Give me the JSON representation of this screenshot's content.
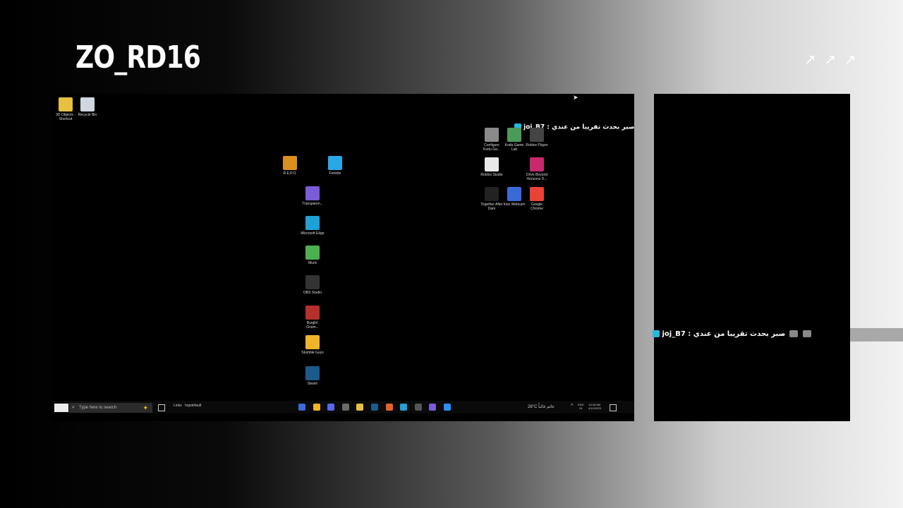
{
  "stream": {
    "title": "ZO_RD16",
    "arrows": [
      "↗",
      "↗",
      "↗"
    ]
  },
  "desktop": {
    "icons_topleft": [
      {
        "label": "3D Objects - Shortcut",
        "icon": "folder-icon",
        "color": "#e8c040"
      },
      {
        "label": "Recycle Bin",
        "icon": "recycle-bin-icon",
        "color": "#cfd8e0"
      }
    ],
    "icons_middle": [
      {
        "label": "R.E.P.O.",
        "icon": "repo-game-icon",
        "color": "#d9901e"
      },
      {
        "label": "Fortnite",
        "icon": "fortnite-icon",
        "color": "#29a8e8"
      },
      {
        "label": "Transparen...",
        "icon": "transparent-chat-icon",
        "color": "#7a5bd8"
      },
      {
        "label": "Microsoft Edge",
        "icon": "edge-icon",
        "color": "#1fa0d6"
      },
      {
        "label": "Muck",
        "icon": "muck-game-icon",
        "color": "#4caf50"
      },
      {
        "label": "OBS Studio",
        "icon": "obs-icon",
        "color": "#333333"
      },
      {
        "label": "Burglin' Gnom...",
        "icon": "burglin-gnomes-icon",
        "color": "#b5302a"
      },
      {
        "label": "Stumble Guys",
        "icon": "stumble-guys-icon",
        "color": "#f0b428"
      },
      {
        "label": "Steam",
        "icon": "steam-icon",
        "color": "#1b5a8a"
      }
    ],
    "icons_right": [
      {
        "label": "Configure Kodu Ga...",
        "icon": "kodu-configure-icon",
        "color": "#8a8a8a"
      },
      {
        "label": "Kodu Game Lab",
        "icon": "kodu-game-lab-icon",
        "color": "#4a9a5a"
      },
      {
        "label": "Roblox Player",
        "icon": "roblox-player-icon",
        "color": "#444444"
      },
      {
        "label": "Roblox Studio",
        "icon": "roblox-studio-icon",
        "color": "#e8e8e8"
      },
      {
        "label": "Drive Beyond Horizons D...",
        "icon": "drive-beyond-horizons-icon",
        "color": "#c8286e"
      },
      {
        "label": "Together After Dark",
        "icon": "epic-games-icon",
        "color": "#222222"
      },
      {
        "label": "Iriun Webcam",
        "icon": "iriun-webcam-icon",
        "color": "#3a6ad8"
      },
      {
        "label": "Google Chrome",
        "icon": "chrome-icon",
        "color": "#e84335"
      }
    ],
    "overlay_chat": {
      "user": "joj_B7",
      "message": ": صبر بحدث تقريبا من عندي"
    }
  },
  "taskbar": {
    "search_placeholder": "Type here to search",
    "links_label": "Links",
    "hop_label": "hopdefault",
    "apps": [
      {
        "icon": "app-icon-1",
        "color": "#3a6ad8"
      },
      {
        "icon": "chrome-canary-icon",
        "color": "#f0b428"
      },
      {
        "icon": "discord-icon",
        "color": "#5865f2"
      },
      {
        "icon": "game-icon",
        "color": "#6a6a6a"
      },
      {
        "icon": "file-explorer-icon",
        "color": "#e8c040"
      },
      {
        "icon": "steam-icon",
        "color": "#1b5a8a"
      },
      {
        "icon": "brave-icon",
        "color": "#e8602a"
      },
      {
        "icon": "edge-icon",
        "color": "#1fa0d6"
      },
      {
        "icon": "obs-icon",
        "color": "#555555"
      },
      {
        "icon": "transparent-chat-icon",
        "color": "#7a5bd8"
      },
      {
        "icon": "zoom-icon",
        "color": "#2d8cff"
      }
    ],
    "weather": "28°C  غائم غالباً",
    "lang_top": "ENG",
    "lang_bottom": "IN",
    "time": "10:48 AM",
    "date": "4/12/2025"
  },
  "chat_panel": {
    "user": "joj_B7",
    "message": ": صبر بحدث تقريبا من عندي"
  }
}
